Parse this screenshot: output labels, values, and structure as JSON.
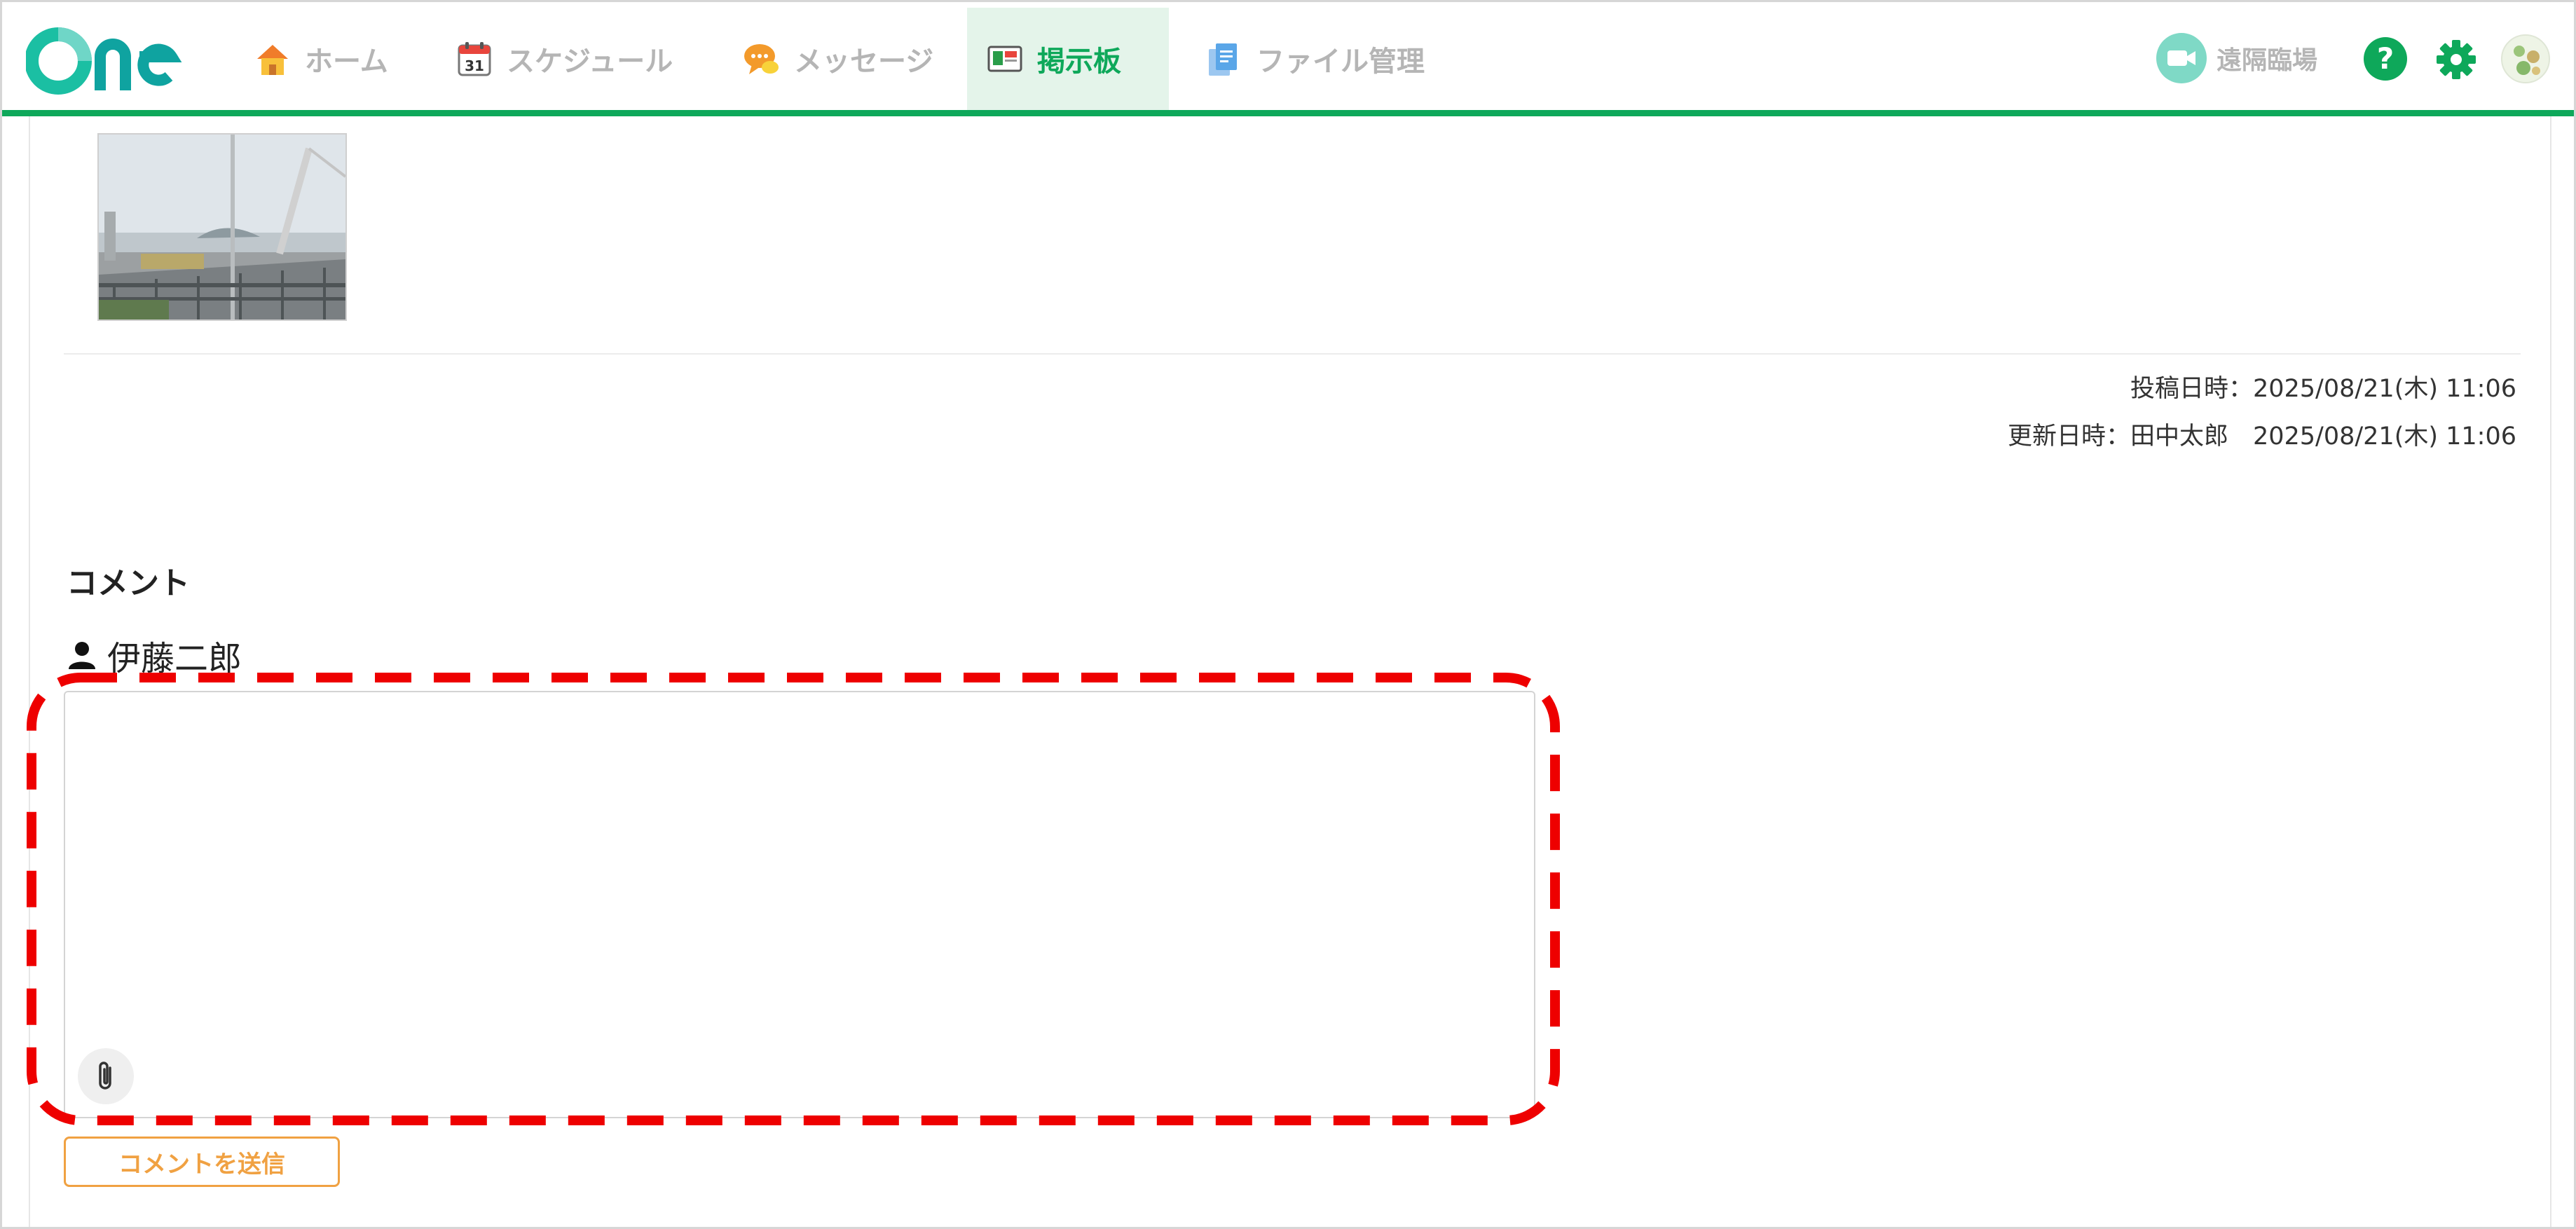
{
  "header": {
    "logo_text": "One",
    "nav": [
      {
        "label": "ホーム",
        "icon": "house-icon",
        "active": false
      },
      {
        "label": "スケジュール",
        "icon": "calendar-icon",
        "calendar_day": "31",
        "active": false
      },
      {
        "label": "メッセージ",
        "icon": "chat-bubble-icon",
        "active": false
      },
      {
        "label": "掲示板",
        "icon": "bulletin-board-icon",
        "active": true
      },
      {
        "label": "ファイル管理",
        "icon": "documents-icon",
        "active": false
      }
    ],
    "remote": {
      "label": "遠隔臨場",
      "icon": "video-camera-icon"
    },
    "right_icons": [
      "help-icon",
      "gear-icon",
      "avatar"
    ]
  },
  "post": {
    "thumbnail": "construction-site-photo",
    "posted": "投稿日時：2025/08/21(木) 11:06",
    "updated": "更新日時：田中太郎　2025/08/21(木) 11:06"
  },
  "comments": {
    "heading": "コメント",
    "user_name": "伊藤二郎",
    "textarea_value": "",
    "submit_label": "コメントを送信"
  },
  "colors": {
    "brand_green": "#0ea85a",
    "logo_teal": "#14b8a6",
    "submit_orange": "#f0a142",
    "highlight_red": "#ee0000",
    "nav_inactive": "#b5b5b5"
  }
}
